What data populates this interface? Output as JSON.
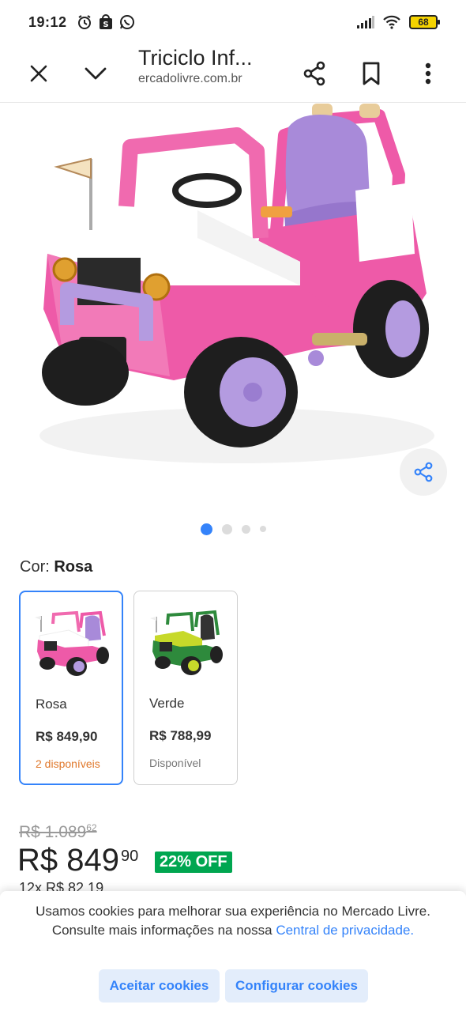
{
  "status_bar": {
    "time": "19:12",
    "battery": "68"
  },
  "browser": {
    "title": "Triciclo Inf...",
    "url": "ercadolivre.com.br"
  },
  "product": {
    "color_label_prefix": "Cor: ",
    "color_selected": "Rosa",
    "gallery": {
      "total": 4,
      "active_index": 0
    },
    "variants": [
      {
        "name": "Rosa",
        "price": "R$ 849,90",
        "stock": "2 disponíveis",
        "color": "#ee5aa8"
      },
      {
        "name": "Verde",
        "price": "R$ 788,99",
        "stock": "Disponível",
        "color": "#2e8a3c"
      }
    ],
    "old_price_main": "R$ 1.089",
    "old_price_cents": "62",
    "price_main": "R$ 849",
    "price_cents": "90",
    "discount": "22% OFF",
    "installments": "12x R$ 82,19"
  },
  "cookie_banner": {
    "text": "Usamos cookies para melhorar sua experiência no Mercado Livre. Consulte mais informações na nossa ",
    "link": "Central de privacidade",
    "text_end": ".",
    "accept_label": "Aceitar cookies",
    "configure_label": "Configurar cookies"
  },
  "colors": {
    "accent": "#3483fa",
    "discount_green": "#00a650",
    "stock_orange": "#e0782b"
  }
}
